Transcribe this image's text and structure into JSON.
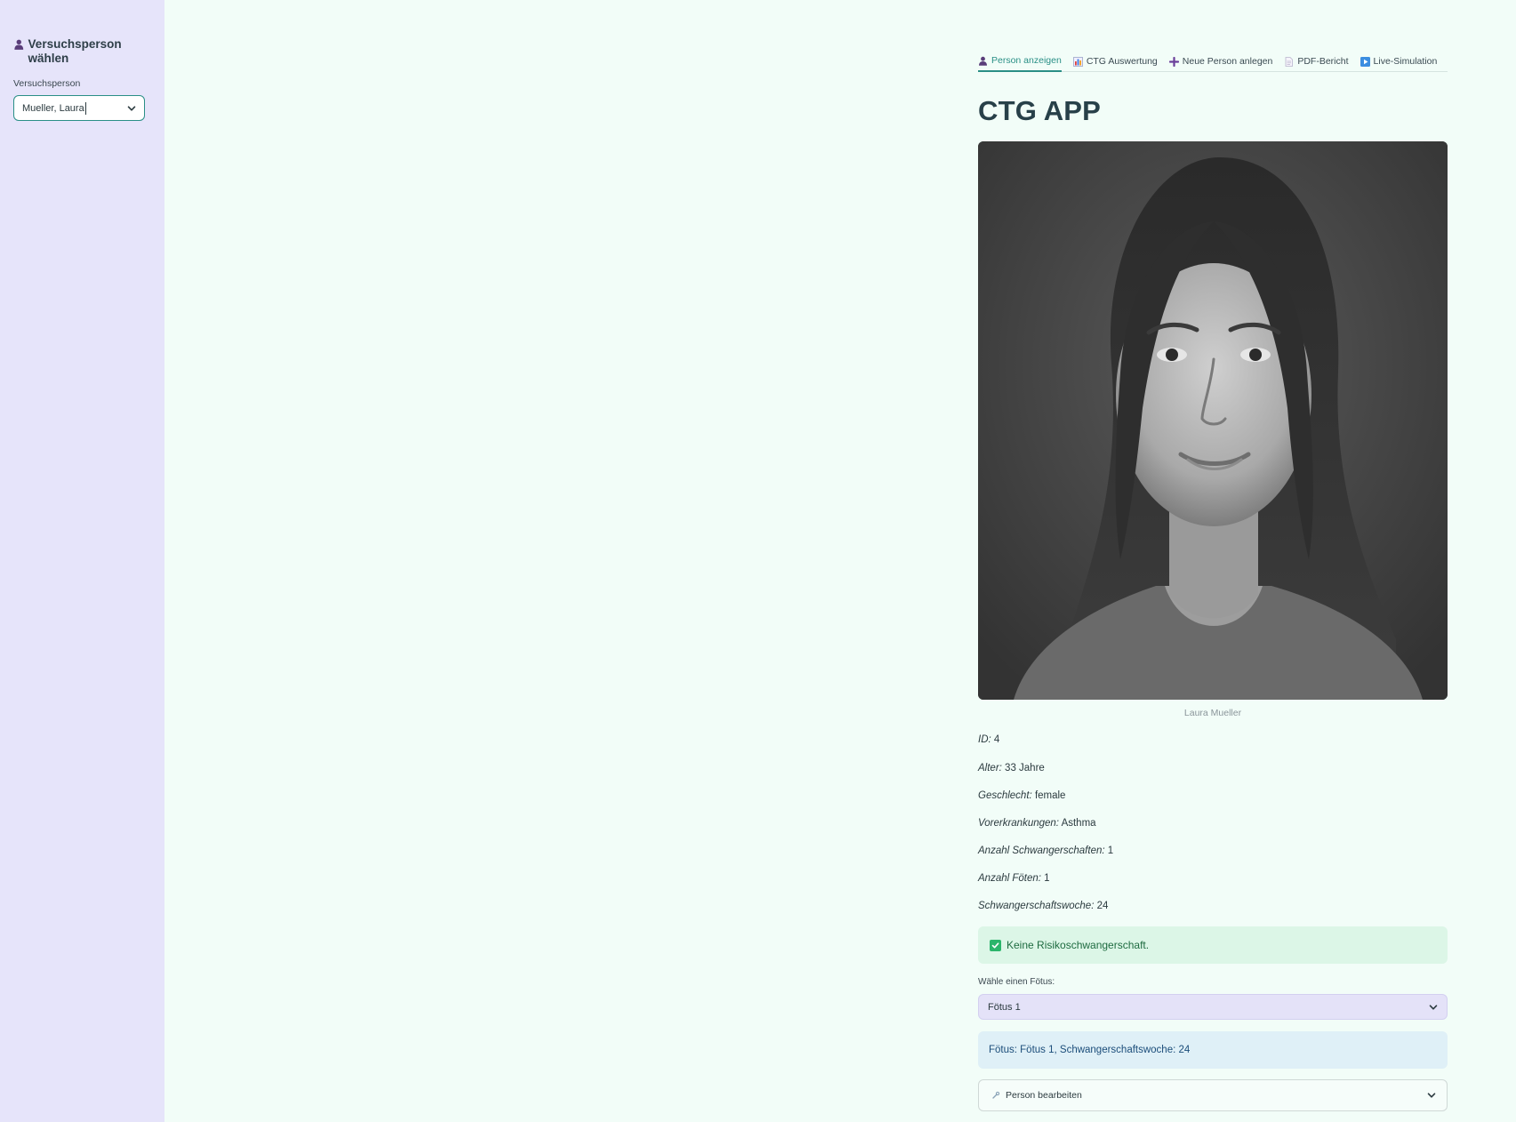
{
  "sidebar": {
    "title": "Versuchsperson wählen",
    "select_label": "Versuchsperson",
    "selected_person": "Mueller, Laura"
  },
  "tabs": [
    {
      "label": "Person anzeigen",
      "icon": "person-icon",
      "active": true
    },
    {
      "label": "CTG Auswertung",
      "icon": "chart-icon",
      "active": false
    },
    {
      "label": "Neue Person anlegen",
      "icon": "plus-icon",
      "active": false
    },
    {
      "label": "PDF-Bericht",
      "icon": "document-icon",
      "active": false
    },
    {
      "label": "Live-Simulation",
      "icon": "play-icon",
      "active": false
    }
  ],
  "main": {
    "title": "CTG APP",
    "photo_caption": "Laura Mueller",
    "facts": [
      {
        "label": "ID:",
        "value": "4"
      },
      {
        "label": "Alter:",
        "value": "33 Jahre"
      },
      {
        "label": "Geschlecht:",
        "value": "female"
      },
      {
        "label": "Vorerkrankungen:",
        "value": "Asthma"
      },
      {
        "label": "Anzahl Schwangerschaften:",
        "value": "1"
      },
      {
        "label": "Anzahl Föten:",
        "value": "1"
      },
      {
        "label": "Schwangerschaftswoche:",
        "value": "24"
      }
    ],
    "risk_status": "Keine Risikoschwangerschaft.",
    "fetus_label": "Wähle einen Fötus:",
    "fetus_selected": "Fötus 1",
    "fetus_info": "Fötus: Fötus 1, Schwangerschaftswoche: 24",
    "edit_expander": "Person bearbeiten"
  },
  "colors": {
    "accent": "#2a8f86",
    "sidebar_bg": "#e6e4fa",
    "page_bg": "#f2fdf8",
    "success_bg": "#dcf6e7",
    "info_bg": "#dff0f7"
  }
}
